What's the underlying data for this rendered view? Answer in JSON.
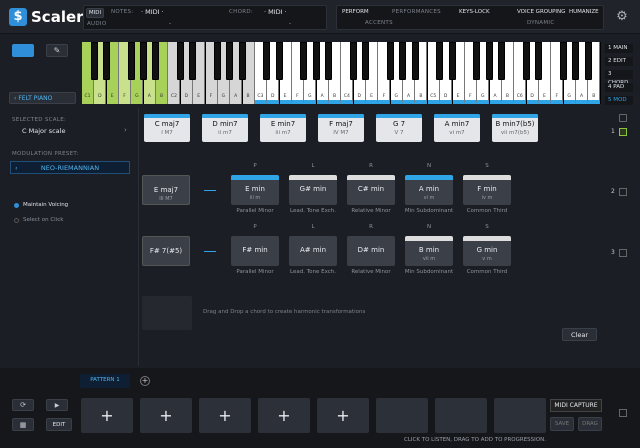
{
  "app": {
    "name": "Scaler"
  },
  "top": {
    "midi_label": "MIDI",
    "audio_label": "AUDIO",
    "notes_label": "NOTES:",
    "notes_value": "· MIDI ·",
    "chord_label": "CHORD:",
    "chord_value": "· MIDI ·",
    "dot": "."
  },
  "perf": {
    "perform": "PERFORM",
    "performances": "PERFORMANCES",
    "accents": "ACCENTS",
    "keys_lock": "KEYS-LOCK",
    "voice_grouping": "VOICE GROUPING",
    "humanize": "HUMANIZE",
    "dynamic": "DYNAMIC"
  },
  "instrument": "FELT PIANO",
  "keyboard": {
    "white": [
      "C1",
      "D",
      "E",
      "F",
      "G",
      "A",
      "B",
      "C2",
      "D",
      "E",
      "F",
      "G",
      "A",
      "B",
      "C3",
      "D",
      "E",
      "F",
      "G",
      "A",
      "B",
      "C4",
      "D",
      "E",
      "F",
      "G",
      "A",
      "B",
      "C5",
      "D",
      "E",
      "F",
      "G",
      "A",
      "B",
      "C6",
      "D",
      "E",
      "F",
      "G",
      "A",
      "B"
    ]
  },
  "side_tabs": [
    "MAIN",
    "EDIT",
    "CHORD",
    "PAD",
    "MOD"
  ],
  "side_nums": [
    "1",
    "2",
    "3"
  ],
  "scale": {
    "label": "SELECTED SCALE:",
    "value": "C Major scale",
    "key": "C"
  },
  "mod": {
    "label": "MODULATION PRESET:",
    "value": "NEO-RIEMANNIAN",
    "maintain": "Maintain Voicing",
    "select": "Select on Click"
  },
  "scale_chords": [
    {
      "n": "C maj7",
      "r": "I M7"
    },
    {
      "n": "D min7",
      "r": "ii m7"
    },
    {
      "n": "E min7",
      "r": "iii m7"
    },
    {
      "n": "F maj7",
      "r": "IV M7"
    },
    {
      "n": "G 7",
      "r": "V 7"
    },
    {
      "n": "A min7",
      "r": "vi m7"
    },
    {
      "n": "B min7(b5)",
      "r": "vii m7(b5)"
    }
  ],
  "row1": {
    "src": {
      "n": "E maj7",
      "r": "III M7"
    },
    "letters": [
      "P",
      "L",
      "R",
      "N",
      "S"
    ],
    "cards": [
      {
        "n": "E min",
        "r": "iii m"
      },
      {
        "n": "G# min",
        "r": ""
      },
      {
        "n": "C# min",
        "r": ""
      },
      {
        "n": "A min",
        "r": "vi m"
      },
      {
        "n": "F min",
        "r": "iv m"
      }
    ],
    "labels": [
      "Parallel Minor",
      "Lead. Tone Exch.",
      "Relative Minor",
      "Min Subdominant",
      "Common Third"
    ]
  },
  "row2": {
    "src": {
      "n": "F# 7(#5)",
      "r": ""
    },
    "letters": [
      "P",
      "L",
      "R",
      "N",
      "S"
    ],
    "cards": [
      {
        "n": "F# min",
        "r": ""
      },
      {
        "n": "A# min",
        "r": ""
      },
      {
        "n": "D# min",
        "r": ""
      },
      {
        "n": "B min",
        "r": "vii m"
      },
      {
        "n": "G min",
        "r": "v m"
      }
    ],
    "labels": [
      "Parallel Minor",
      "Lead. Tone Exch.",
      "Relative Minor",
      "Min Subdominant",
      "Common Third"
    ]
  },
  "drop_hint": "Drag and Drop a chord to create harmonic transformations",
  "clear": "Clear",
  "pattern": "PATTERN 1",
  "add": "+",
  "edit": "EDIT",
  "capture": "MIDI CAPTURE",
  "save": "SAVE",
  "drag": "DRAG",
  "footer": "CLICK TO LISTEN, DRAG TO ADD TO PROGRESSION.",
  "colors": {
    "accent": "#2fa5e8",
    "green": "#a8d15a"
  }
}
